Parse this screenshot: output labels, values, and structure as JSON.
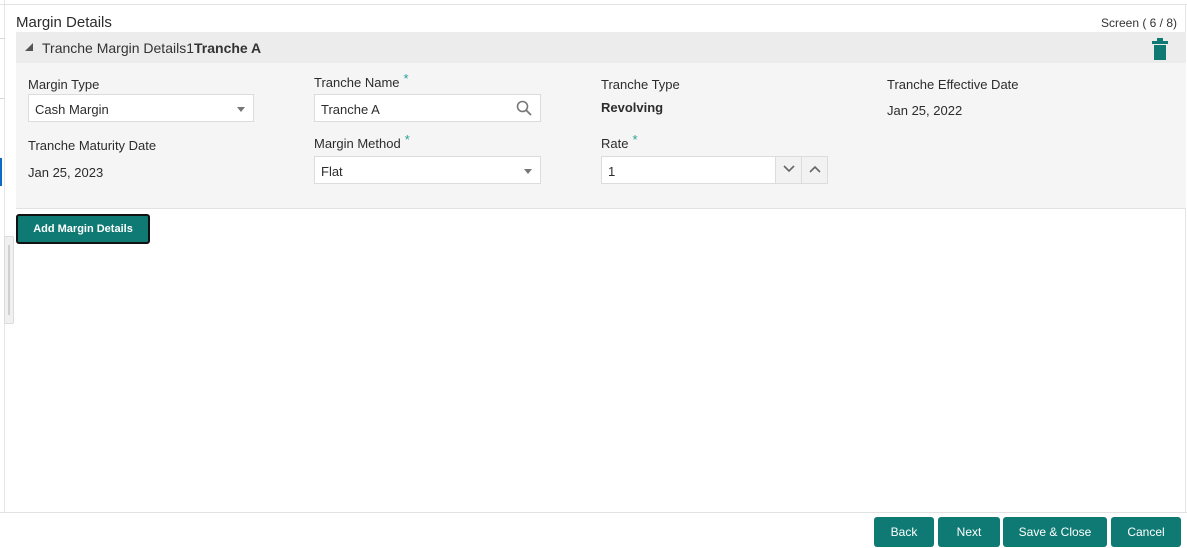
{
  "page": {
    "title": "Margin Details",
    "screen_indicator": "Screen ( 6 / 8)"
  },
  "section": {
    "title_prefix": "Tranche Margin Details1",
    "title_bold": "Tranche A",
    "collapse_icon": "triangle-collapse-icon",
    "delete_icon": "trash-icon",
    "accent_color": "#0f7a73"
  },
  "fields": {
    "margin_type": {
      "label": "Margin Type",
      "value": "Cash Margin"
    },
    "tranche_name": {
      "label": "Tranche Name",
      "value": "Tranche A",
      "required": "*"
    },
    "tranche_type": {
      "label": "Tranche Type",
      "value": "Revolving"
    },
    "tranche_effective_date": {
      "label": "Tranche Effective Date",
      "value": "Jan 25, 2022"
    },
    "tranche_maturity_date": {
      "label": "Tranche Maturity Date",
      "value": "Jan 25, 2023"
    },
    "margin_method": {
      "label": "Margin Method",
      "value": "Flat",
      "required": "*"
    },
    "rate": {
      "label": "Rate",
      "value": "1",
      "required": "*"
    }
  },
  "actions": {
    "add_margin": "Add Margin Details"
  },
  "footer": {
    "back": "Back",
    "next": "Next",
    "save_close": "Save & Close",
    "cancel": "Cancel"
  }
}
